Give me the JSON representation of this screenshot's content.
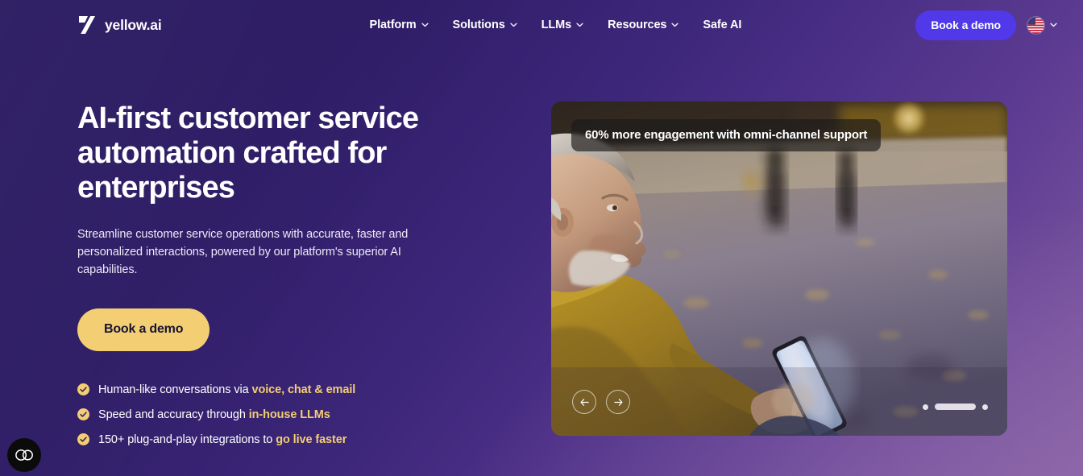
{
  "brand": {
    "name": "yellow.ai",
    "logo_icon": "yellow-ai-logo-icon"
  },
  "nav": {
    "items": [
      {
        "label": "Platform",
        "has_dropdown": true
      },
      {
        "label": "Solutions",
        "has_dropdown": true
      },
      {
        "label": "LLMs",
        "has_dropdown": true
      },
      {
        "label": "Resources",
        "has_dropdown": true
      },
      {
        "label": "Safe AI",
        "has_dropdown": false
      }
    ],
    "cta_label": "Book a demo",
    "language_flag": "us-flag-icon"
  },
  "hero": {
    "headline": "AI-first customer service automation crafted for enterprises",
    "subhead": "Streamline customer service operations with accurate, faster and personalized interactions, powered by our platform's superior AI capabilities.",
    "cta_label": "Book a demo",
    "bullets": [
      {
        "text": "Human-like conversations via ",
        "highlight": "voice, chat & email",
        "tail": ""
      },
      {
        "text": "Speed and accuracy through ",
        "highlight": "in-house LLMs",
        "tail": ""
      },
      {
        "text": "150+ plug-and-play integrations to ",
        "highlight": "go live faster",
        "tail": ""
      }
    ]
  },
  "media": {
    "caption": "60% more engagement with omni-channel support",
    "prev_label": "Previous slide",
    "next_label": "Next slide",
    "slide_count": 3,
    "active_slide": 2,
    "alt": "Older man in a mustard sweater smiling at a glowing phone on a beach at dusk"
  },
  "widgets": {
    "accessibility_label": "Accessibility options"
  },
  "colors": {
    "bg_dark": "#2b1b61",
    "bg_light": "#86609f",
    "accent_yellow": "#f3ce72",
    "accent_indigo": "#5138e8",
    "text_on_dark": "#ffffff"
  }
}
